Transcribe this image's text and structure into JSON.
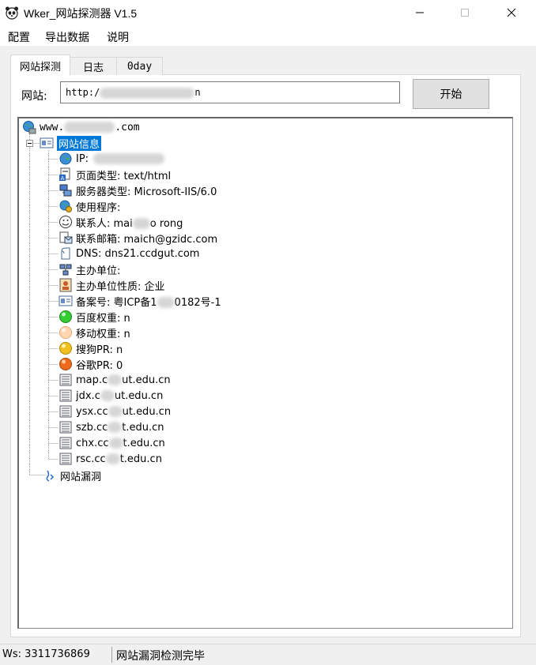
{
  "window": {
    "title": "Wker_网站探测器 V1.5",
    "icon": "panda-app-icon",
    "controls": {
      "minimize": "minimize-icon",
      "maximize": "maximize-icon",
      "close": "close-icon"
    }
  },
  "menu": [
    {
      "label": "配置"
    },
    {
      "label": "导出数据"
    },
    {
      "label": "说明"
    }
  ],
  "tabs": [
    {
      "label": "网站探测",
      "active": true
    },
    {
      "label": "日志",
      "active": false
    },
    {
      "label": "0day",
      "active": false
    }
  ],
  "site": {
    "label": "网站:",
    "value_prefix": "http:/",
    "value_suffix": "n"
  },
  "start_button": {
    "label": "开始"
  },
  "tree": {
    "root": {
      "prefix": "www.",
      "suffix": ".com",
      "icon": "globe-network-icon"
    },
    "site_info": {
      "label": "网站信息",
      "icon": "info-card-icon",
      "selected": true
    },
    "items": [
      {
        "text": "IP:",
        "icon": "globe-icon"
      },
      {
        "text": "页面类型: text/html",
        "icon": "page-type-icon"
      },
      {
        "text": "服务器类型: Microsoft-IIS/6.0",
        "icon": "server-icon"
      },
      {
        "text": "使用程序:",
        "icon": "globe-gear-icon"
      },
      {
        "text": "联系人: mai",
        "text2": "o rong",
        "icon": "smiley-icon"
      },
      {
        "text": "联系邮箱: maich@gzidc.com",
        "icon": "email-icon"
      },
      {
        "text": "DNS: dns21.ccdgut.com",
        "icon": "dns-icon"
      },
      {
        "text": "主办单位:",
        "icon": "organization-icon"
      },
      {
        "text": "主办单位性质: 企业",
        "icon": "person-card-icon"
      },
      {
        "text": "备案号: 粤ICP备1",
        "text2": "0182号-1",
        "icon": "id-card-icon"
      },
      {
        "text": "百度权重: n",
        "icon": "green-ball-icon"
      },
      {
        "text": "移动权重: n",
        "icon": "peach-ball-icon"
      },
      {
        "text": "搜狗PR: n",
        "icon": "yellow-ball-icon"
      },
      {
        "text": "谷歌PR: 0",
        "icon": "orange-ball-icon"
      },
      {
        "text": "map.c",
        "text2": "ut.edu.cn",
        "icon": "list-icon"
      },
      {
        "text": "jdx.c",
        "text2": "ut.edu.cn",
        "icon": "list-icon"
      },
      {
        "text": "ysx.cc",
        "text2": "ut.edu.cn",
        "icon": "list-icon"
      },
      {
        "text": "szb.cc",
        "text2": "t.edu.cn",
        "icon": "list-icon"
      },
      {
        "text": "chx.cc",
        "text2": "t.edu.cn",
        "icon": "list-icon"
      },
      {
        "text": "rsc.cc",
        "text2": "t.edu.cn",
        "icon": "list-icon"
      }
    ],
    "vuln": {
      "label": "网站漏洞",
      "icon": "bug-icon"
    }
  },
  "status": {
    "ws": "Ws: 3311736869",
    "message": "网站漏洞检测完毕"
  },
  "colors": {
    "selection": "#0078d7",
    "window_bg": "#f0f0f0"
  }
}
